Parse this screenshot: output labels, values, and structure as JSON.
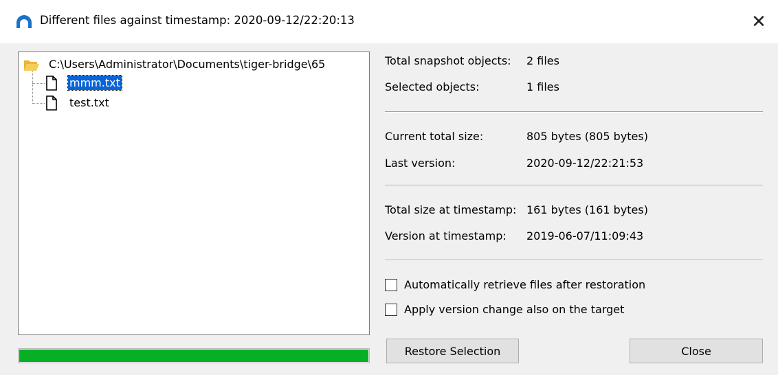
{
  "window": {
    "title": "Different files against timestamp: 2020-09-12/22:20:13",
    "close_glyph": "✕",
    "icon": "cloud-app-icon",
    "accent": "#0a64d8"
  },
  "tree": {
    "root": {
      "icon": "folder-open-icon",
      "label": "C:\\Users\\Administrator\\Documents\\tiger-bridge\\65"
    },
    "items": [
      {
        "icon": "file-icon",
        "label": "mmm.txt",
        "selected": true
      },
      {
        "icon": "file-icon",
        "label": "test.txt",
        "selected": false
      }
    ]
  },
  "progress": {
    "percent": 100,
    "color": "#06b025"
  },
  "info": {
    "total_snapshot": {
      "label": "Total snapshot objects:",
      "value": "2 files"
    },
    "selected": {
      "label": "Selected objects:",
      "value": "1 files"
    },
    "current_size": {
      "label": "Current total size:",
      "value": "805 bytes (805 bytes)"
    },
    "last_version": {
      "label": "Last version:",
      "value": "2020-09-12/22:21:53"
    },
    "size_at_ts": {
      "label": "Total size at timestamp:",
      "value": "161 bytes (161 bytes)"
    },
    "version_at_ts": {
      "label": "Version at timestamp:",
      "value": "2019-06-07/11:09:43"
    }
  },
  "options": {
    "auto_retrieve": {
      "label": "Automatically retrieve files after restoration",
      "checked": false
    },
    "apply_version": {
      "label": "Apply version change also on the target",
      "checked": false
    }
  },
  "buttons": {
    "restore": "Restore Selection",
    "close": "Close"
  }
}
